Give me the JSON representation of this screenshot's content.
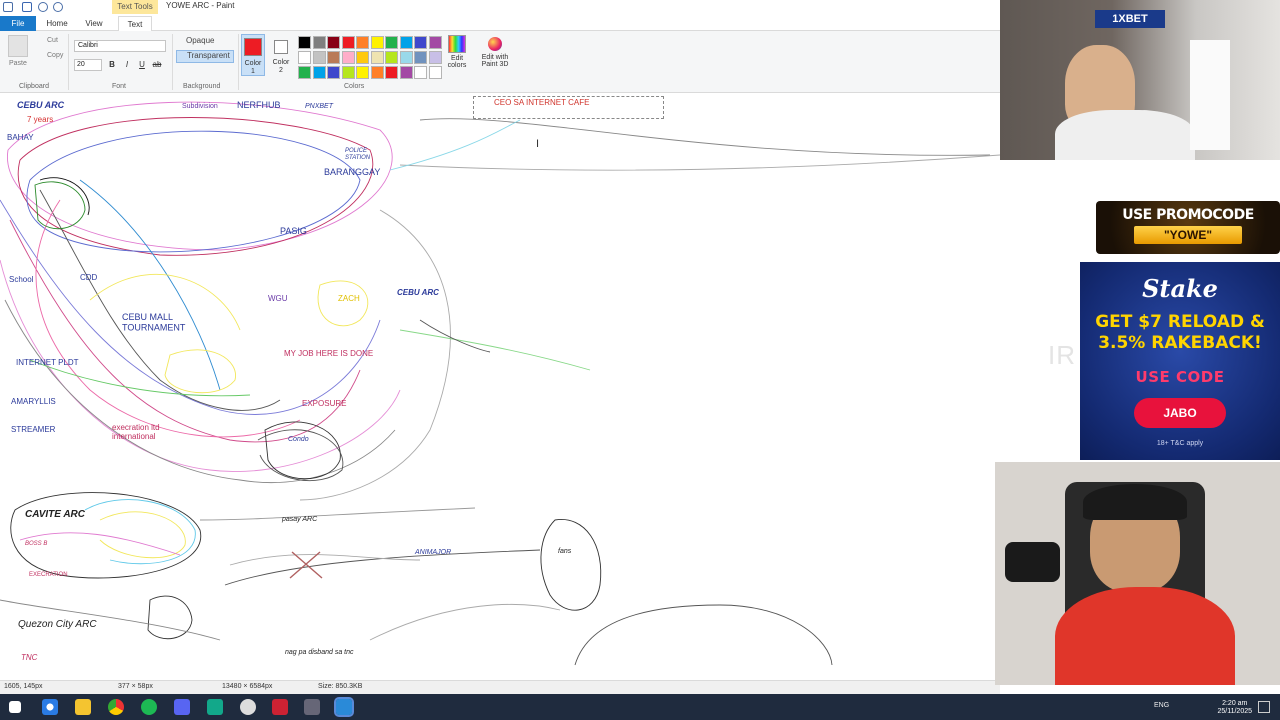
{
  "app": {
    "window_title": "YOWE ARC - Paint",
    "contextual_tab": "Text Tools"
  },
  "ribbon": {
    "tabs": [
      "File",
      "Home",
      "View",
      "Text"
    ],
    "clipboard": {
      "paste": "Paste",
      "cut": "Cut",
      "copy": "Copy",
      "label": "Clipboard"
    },
    "font": {
      "family": "Calibri",
      "size": "20",
      "label": "Font",
      "bold": "B",
      "italic": "I",
      "underline": "U",
      "strike": "ab"
    },
    "background": {
      "opaque": "Opaque",
      "transparent": "Transparent",
      "label": "Background"
    },
    "colors": {
      "color1": "Color 1",
      "color2": "Color 2",
      "label": "Colors",
      "edit": "Edit colors",
      "paint3d": "Edit with Paint 3D",
      "color1_value": "#ed1c24",
      "color2_value": "#ffffff",
      "palette": [
        "#000000",
        "#7f7f7f",
        "#880015",
        "#ed1c24",
        "#ff7f27",
        "#fff200",
        "#22b14c",
        "#00a2e8",
        "#3f48cc",
        "#a349a4",
        "#ffffff",
        "#c3c3c3",
        "#b97a57",
        "#ffaec9",
        "#ffc90e",
        "#efe4b0",
        "#b5e61d",
        "#99d9ea",
        "#7092be",
        "#c8bfe7",
        "#22b14c",
        "#00a2e8",
        "#3f48cc",
        "#b5e61d",
        "#fff200",
        "#ff7f27",
        "#ed1c24",
        "#a349a4",
        "#ffffff",
        "#ffffff"
      ]
    }
  },
  "canvas": {
    "textbox_text": "CEO SA INTERNET CAFE",
    "labels": {
      "cebu_arc": "CEBU ARC",
      "years": "7 years",
      "bahay": "BAHAY",
      "subdivision": "Subdivision",
      "nerfhub": "NERFHUB",
      "pnxbet": "PNXBET",
      "police": "POLICE STATION",
      "barangay": "BARANGGAY",
      "pasig": "PASIG",
      "school": "School",
      "cdd": "CDD",
      "cebu_mall": "CEBU MALL TOURNAMENT",
      "wgu": "WGU",
      "zach": "ZACH",
      "cebu_arc2": "CEBU ARC",
      "internet": "INTERNET PLDT",
      "myjob": "MY JOB HERE IS DONE",
      "amaryllis": "AMARYLLIS",
      "streamer": "STREAMER",
      "execration": "execration ltd international",
      "exposure": "EXPOSURE",
      "condo": "Condo",
      "cavite": "CAVITE ARC",
      "boss": "BOSS B",
      "execration2": "EXECRATION",
      "pasay": "pasay ARC",
      "animajor": "ANIMAJOR",
      "fans": "fans",
      "qc": "Quezon City ARC",
      "tnc": "TNC",
      "disband": "nag pa disband sa tnc"
    }
  },
  "status": {
    "cursor": "1605, 145px",
    "selection": "377 × 58px",
    "canvas_size": "13480 × 6584px",
    "file_size": "Size: 850.3KB"
  },
  "overlays": {
    "promo_line1": "USE PROMOCODE",
    "promo_line2": "\"YOWE\"",
    "stake_logo": "Stake",
    "stake_offer_1": "GET $7 RELOAD &",
    "stake_offer_2": "3.5% RAKEBACK!",
    "stake_use": "USE CODE",
    "stake_code": "JABO",
    "stake_tc": "18+ T&C apply",
    "sponsor": "1XBET"
  },
  "taskbar": {
    "lang": "ENG",
    "time": "2:20 am",
    "date": "25/11/2025"
  }
}
